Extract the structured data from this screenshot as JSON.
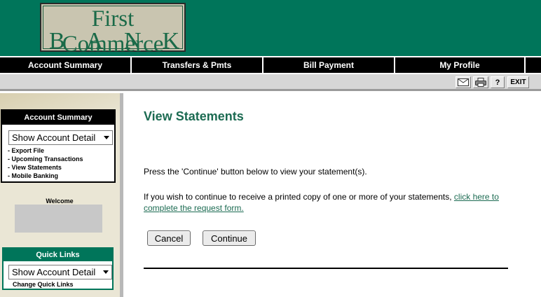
{
  "logo": {
    "line1": "First Commerce",
    "line2": [
      "B",
      "A",
      "N",
      "K"
    ]
  },
  "nav": {
    "items": [
      {
        "label": "Account Summary"
      },
      {
        "label": "Transfers & Pmts"
      },
      {
        "label": "Bill Payment"
      },
      {
        "label": "My Profile"
      }
    ]
  },
  "toolbar": {
    "help_label": "?",
    "exit_label": "EXIT"
  },
  "sidebar": {
    "account_box": {
      "title": "Account Summary",
      "select_value": "Show Account Detail",
      "links": [
        "- Export File",
        "- Upcoming Transactions",
        "- View Statements",
        "- Mobile Banking"
      ]
    },
    "welcome_label": "Welcome",
    "quick_links": {
      "title": "Quick Links",
      "select_value": "Show Account Detail",
      "link": "Change Quick Links"
    }
  },
  "main": {
    "title": "View Statements",
    "instruction": "Press the 'Continue' button below to view your statement(s).",
    "printed_text": "If you wish to continue to receive a printed copy of one or more of your statements, ",
    "printed_link": "click here to complete the request form.",
    "cancel_label": "Cancel",
    "continue_label": "Continue"
  },
  "colors": {
    "brand_green": "#00755a",
    "title_green": "#1c6b52",
    "nav_bg": "#000000"
  }
}
